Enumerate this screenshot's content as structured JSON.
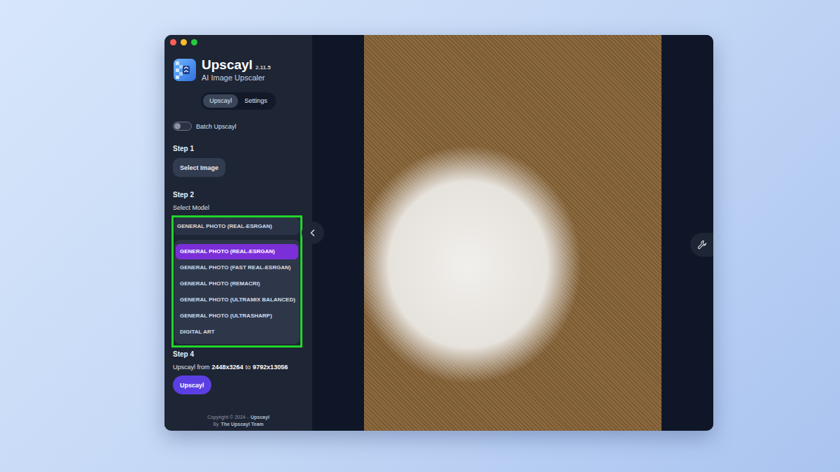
{
  "app": {
    "name": "Upscayl",
    "version": "2.11.5",
    "subtitle": "AI Image Upscaler"
  },
  "tabs": [
    {
      "label": "Upscayl",
      "selected": true
    },
    {
      "label": "Settings",
      "selected": false
    }
  ],
  "batch": {
    "label": "Batch Upscayl",
    "on": false
  },
  "step1": {
    "title": "Step 1",
    "button": "Select Image"
  },
  "step2": {
    "title": "Step 2",
    "label": "Select Model",
    "value": "GENERAL PHOTO (REAL-ESRGAN)",
    "expanded": true,
    "options": [
      {
        "label": "GENERAL PHOTO (REAL-ESRGAN)",
        "selected": true
      },
      {
        "label": "GENERAL PHOTO (FAST REAL-ESRGAN)",
        "selected": false
      },
      {
        "label": "GENERAL PHOTO (REMACRI)",
        "selected": false
      },
      {
        "label": "GENERAL PHOTO (ULTRAMIX BALANCED)",
        "selected": false
      },
      {
        "label": "GENERAL PHOTO (ULTRASHARP)",
        "selected": false
      },
      {
        "label": "DIGITAL ART",
        "selected": false
      }
    ]
  },
  "step4": {
    "title": "Step 4",
    "prefix": "Upscayl from",
    "from": "2448x3264",
    "joiner": "to",
    "to": "9792x13056",
    "button": "Upscayl"
  },
  "footer": {
    "line1": "Copyright © 2024 -",
    "line1_name": "Upscayl",
    "line2": "By",
    "line2_name": "The Upscayl Team"
  }
}
